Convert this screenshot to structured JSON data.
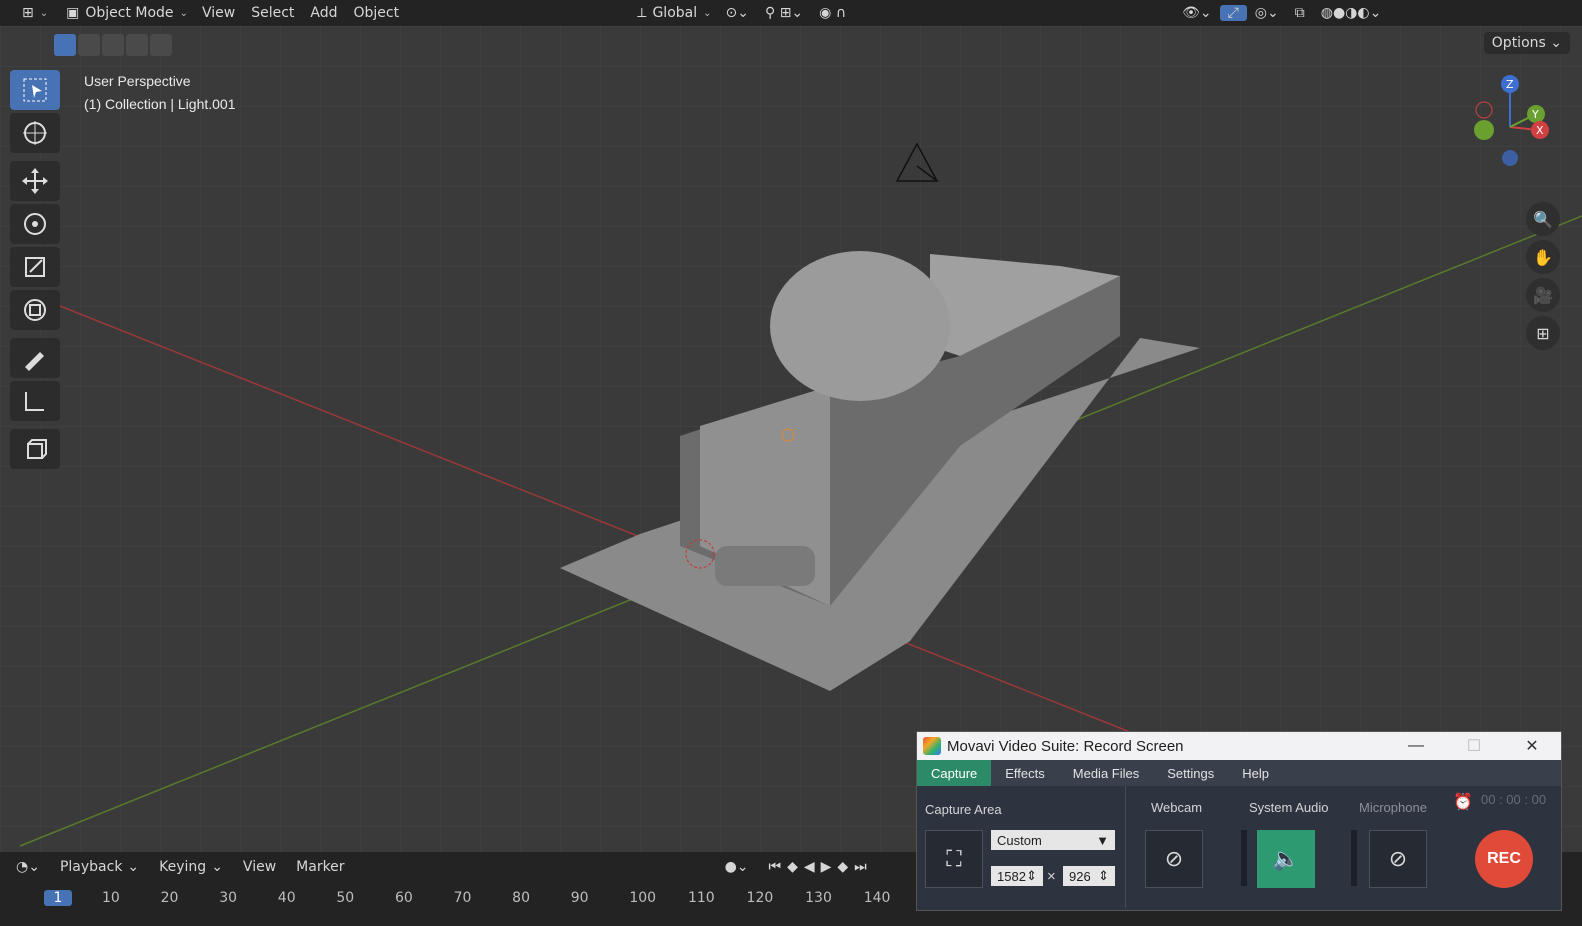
{
  "topbar": {
    "mode": "Object Mode",
    "menus": [
      "View",
      "Select",
      "Add",
      "Object"
    ],
    "transform": "Global"
  },
  "viewport": {
    "perspective": "User Perspective",
    "collection": "(1) Collection | Light.001",
    "options_label": "Options",
    "axes": [
      "Z",
      "Y",
      "X"
    ]
  },
  "timeline": {
    "menus": [
      "Playback",
      "Keying",
      "View",
      "Marker"
    ],
    "current_frame": "1",
    "frames": [
      "10",
      "20",
      "30",
      "40",
      "50",
      "60",
      "70",
      "80",
      "90",
      "100",
      "110",
      "120",
      "130",
      "140"
    ]
  },
  "movavi": {
    "title": "Movavi Video Suite: Record Screen",
    "tabs": [
      "Capture",
      "Effects",
      "Media Files",
      "Settings",
      "Help"
    ],
    "capture_area_label": "Capture Area",
    "capture_preset": "Custom",
    "width": "1582",
    "height": "926",
    "times": "×",
    "webcam_label": "Webcam",
    "system_audio_label": "System Audio",
    "microphone_label": "Microphone",
    "rec_label": "REC",
    "timer": "00 : 00 : 00"
  }
}
